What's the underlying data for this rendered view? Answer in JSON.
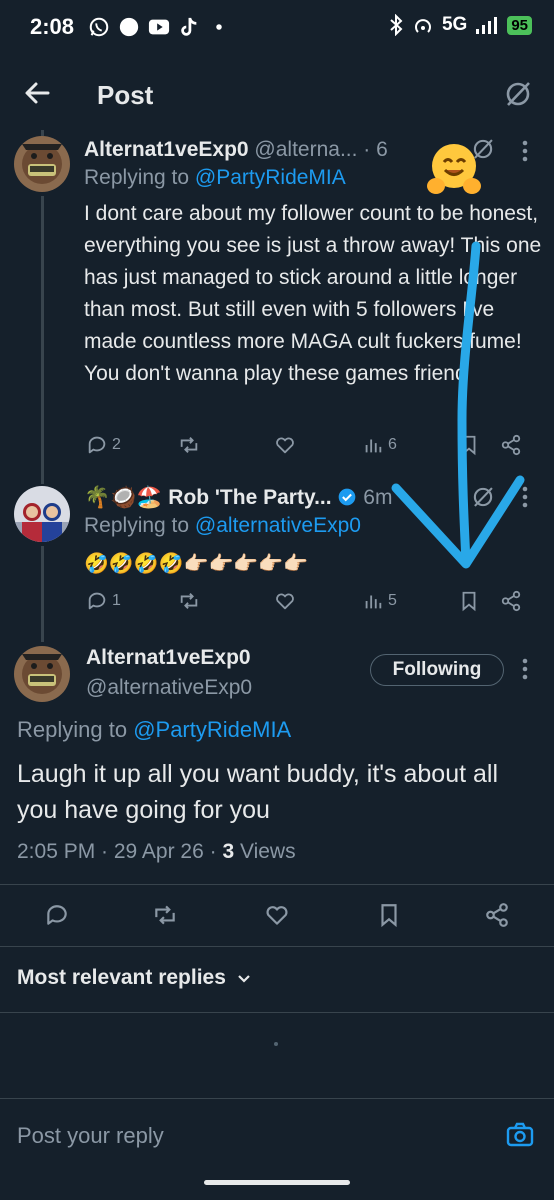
{
  "status_bar": {
    "time": "2:08",
    "network": "5G",
    "battery": "95"
  },
  "header": {
    "title": "Post"
  },
  "reply1": {
    "name": "Alternat1veExp0",
    "handle": "@alterna...",
    "time": "· 6",
    "replying_prefix": "Replying to ",
    "replying_to": "@PartyRideMIA",
    "text": "I dont care about my follower count to be honest, everything you see is just a throw away! This one has just managed to stick around a little longer than most. But still even with 5 followers I've made countless more MAGA cult fuckers fume! You don't wanna play these games friend",
    "replies": "2",
    "views": "6"
  },
  "reply2": {
    "name": "🌴🥥🏖️ Rob 'The Party...",
    "time": "6m",
    "replying_prefix": "Replying to ",
    "replying_to": "@alternativeExp0",
    "text": "🤣🤣🤣🤣👉🏻👉🏻👉🏻👉🏻👉🏻",
    "replies": "1",
    "views": "5"
  },
  "main_post": {
    "name": "Alternat1veExp0",
    "handle": "@alternativeExp0",
    "follow_label": "Following",
    "replying_prefix": "Replying to ",
    "replying_to": "@PartyRideMIA",
    "text": "Laugh it up all you want buddy, it's about all you have going for you",
    "meta_prefix": "2:05 PM · 29 Apr 26 · ",
    "views_count": "3",
    "views_label": " Views"
  },
  "replies_sort": {
    "label": "Most relevant replies"
  },
  "composer": {
    "placeholder": "Post your reply"
  },
  "colors": {
    "background": "#15202b",
    "accent": "#1d9bf0",
    "muted": "#8b98a5",
    "annotation_arrow": "#29a8e8"
  }
}
